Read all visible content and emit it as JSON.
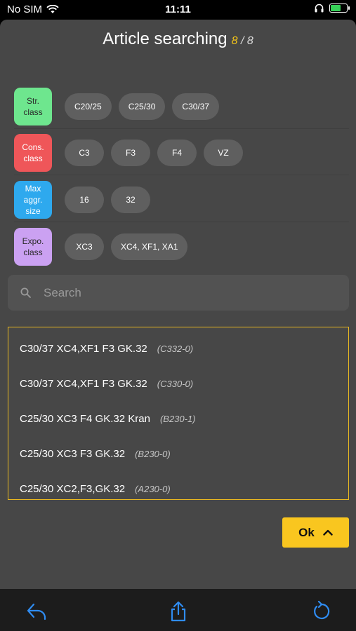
{
  "status_bar": {
    "carrier": "No SIM",
    "time": "11:11",
    "icons": [
      "wifi-icon",
      "headphones-icon",
      "battery-icon"
    ]
  },
  "header": {
    "title": "Article searching",
    "count_current": "8",
    "count_sep": "/",
    "count_total": "8"
  },
  "filters": [
    {
      "category": "Str.\nclass",
      "color": "#6ee68e",
      "chips": [
        "C20/25",
        "C25/30",
        "C30/37"
      ]
    },
    {
      "category": "Cons.\nclass",
      "color": "#ef5659",
      "chips": [
        "C3",
        "F3",
        "F4",
        "VZ"
      ]
    },
    {
      "category": "Max\naggr.\nsize",
      "color": "#2ea9ee",
      "chips": [
        "16",
        "32"
      ]
    },
    {
      "category": "Expo.\nclass",
      "color": "#cba1f2",
      "chips": [
        "XC3",
        "XC4, XF1, XA1"
      ]
    }
  ],
  "search": {
    "placeholder": "Search",
    "value": ""
  },
  "results": [
    {
      "name": "C30/37 XC4,XF1 F3 GK.32",
      "code": "(C332-0)"
    },
    {
      "name": "C30/37 XC4,XF1 F3 GK.32",
      "code": "(C330-0)"
    },
    {
      "name": "C25/30 XC3 F4 GK.32 Kran",
      "code": "(B230-1)"
    },
    {
      "name": "C25/30 XC3 F3 GK.32",
      "code": "(B230-0)"
    },
    {
      "name": "C25/30 XC2,F3,GK.32",
      "code": "(A230-0)"
    }
  ],
  "ok_button": {
    "label": "Ok",
    "icon": "chevron-up-icon"
  },
  "toolbar": {
    "icons": [
      "reply-icon",
      "share-icon",
      "refresh-icon"
    ]
  },
  "colors": {
    "accent": "#f9c61f",
    "toolbar_icon": "#2f8cf2",
    "sheet": "#474747"
  }
}
